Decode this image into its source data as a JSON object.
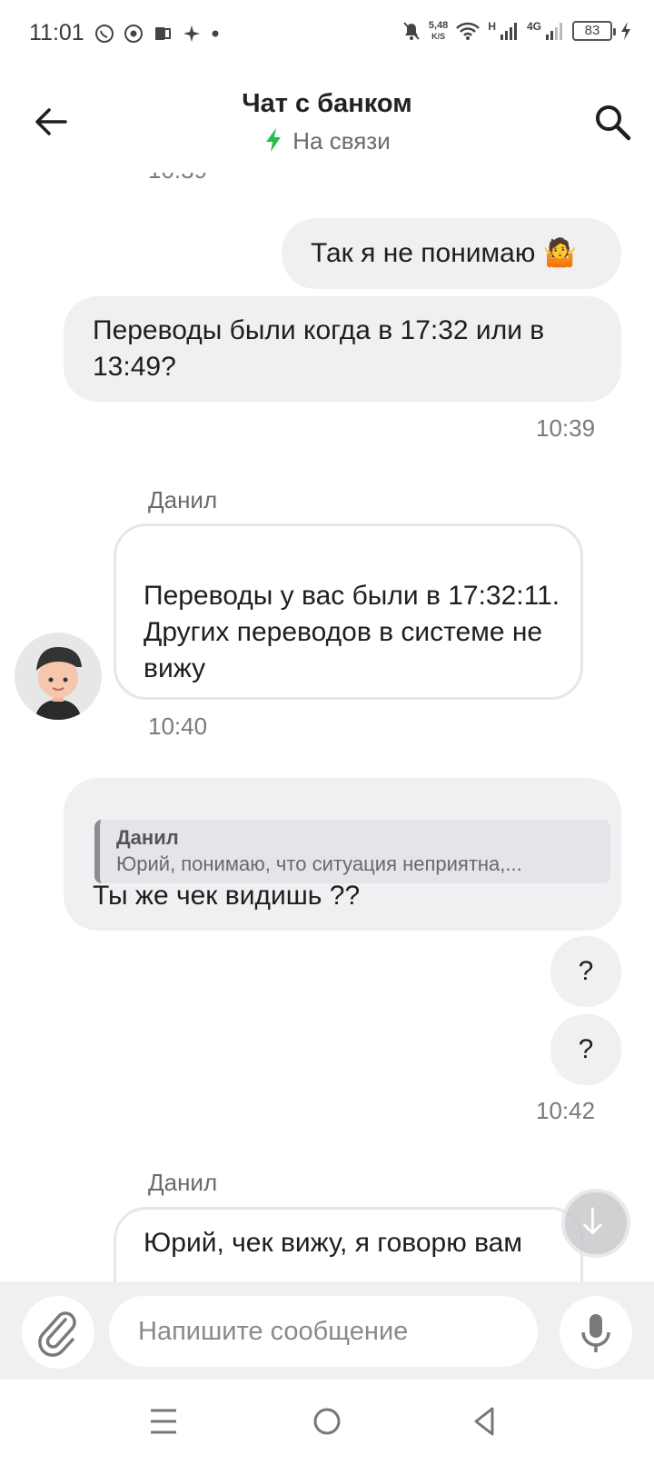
{
  "status_bar": {
    "time": "11:01",
    "speed_value": "5,48",
    "speed_unit": "K/S",
    "net_h": "H",
    "net_4g": "4G",
    "battery": "83"
  },
  "header": {
    "title": "Чат с банком",
    "status": "На связи",
    "status_color": "#22c04a"
  },
  "chat": {
    "cut_time": "10:39",
    "messages": [
      {
        "text": "Так я не понимаю 🤷"
      },
      {
        "text": "Переводы были когда в 17:32 или в 13:49?",
        "time": "10:39"
      },
      {
        "sender": "Данил",
        "text": "Переводы у вас были в 17:32:11.\nДругих переводов в системе не вижу",
        "time": "10:40"
      },
      {
        "quote_author": "Данил",
        "quote_text": "Юрий, понимаю, что ситуация неприятна,...",
        "text": "Ты же чек видишь ??"
      },
      {
        "text": "?"
      },
      {
        "text": "?",
        "time": "10:42"
      },
      {
        "sender": "Данил",
        "text": "Юрий, чек вижу, я говорю вам"
      }
    ]
  },
  "input": {
    "placeholder": "Напишите сообщение"
  },
  "icons": {
    "back": "arrow-left-icon",
    "search": "search-icon",
    "attach": "paperclip-icon",
    "mic": "microphone-icon",
    "scroll": "arrow-down-icon"
  }
}
